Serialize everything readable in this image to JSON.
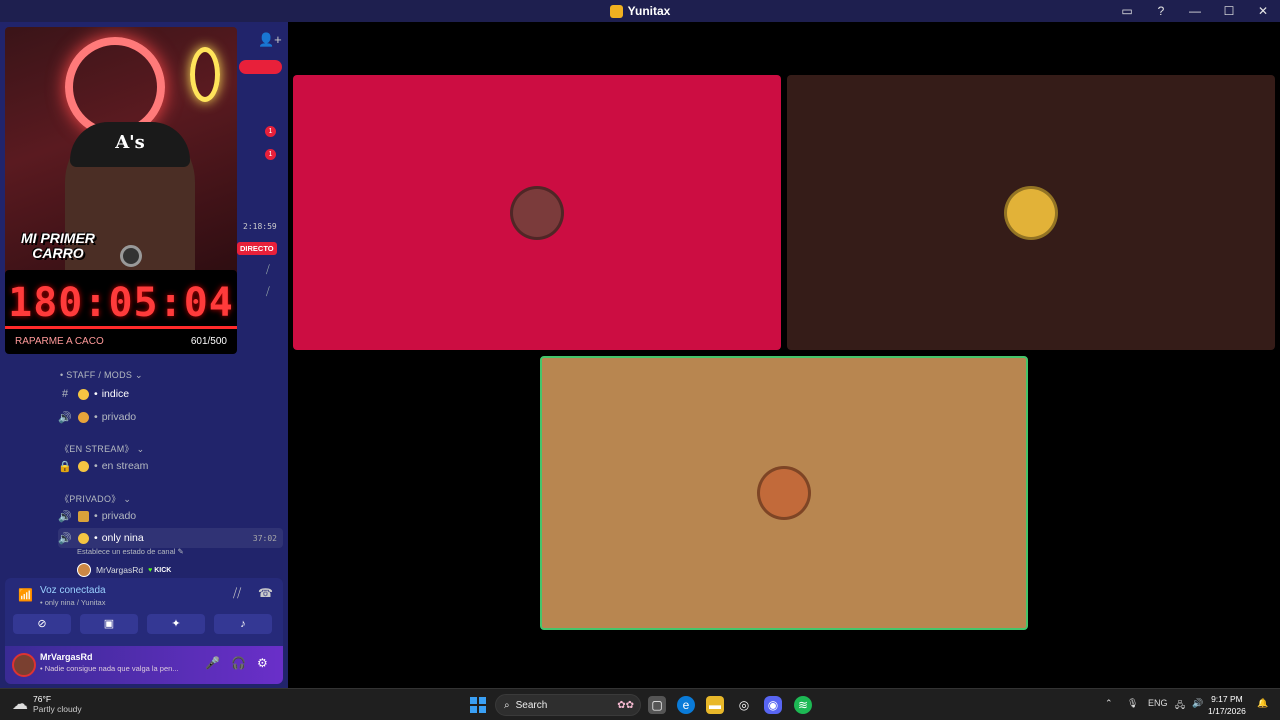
{
  "window": {
    "title": "Yunitax",
    "controls": [
      "▭",
      "?",
      "—",
      "☐",
      "✕"
    ]
  },
  "overlay": {
    "cap_text": "A's",
    "banner_line1": "MI PRIMER",
    "banner_line2": "CARRO",
    "timer": "180:05:04",
    "goal_label": "RAPARME A CACO",
    "goal_count": "601/500"
  },
  "sidebar": {
    "badges": [
      "1",
      "1"
    ],
    "stream_time": "2:18:59",
    "live_label": "DIRECTO",
    "categories": {
      "staff": "• STAFF / MODS ⌄",
      "en_stream": "《EN STREAM》 ⌄",
      "privado": "《PRIVADO》 ⌄"
    },
    "channels": {
      "indice": "indice",
      "privado1": "privado",
      "en_stream": "en stream",
      "privado2": "privado",
      "only_nina": "only nina",
      "only_nina_time": "37:02"
    },
    "channel_status": "Establece un estado de canal ✎",
    "member": {
      "name": "MrVargasRd",
      "tag": "KICK"
    }
  },
  "voice": {
    "title": "Voz conectada",
    "subtitle": "• only nina / Yunitax"
  },
  "user": {
    "name": "MrVargasRd",
    "status": "• Nadie consigue nada que valga la pen..."
  },
  "tiles": [
    {
      "name": "red-tile",
      "color": "#cc0d42",
      "avatar_color": "#7b3b3b"
    },
    {
      "name": "brown-tile",
      "color": "#351c18",
      "avatar_color": "#e2b238"
    },
    {
      "name": "tan-tile",
      "color": "#b88650",
      "avatar_color": "#c26a3a"
    }
  ],
  "taskbar": {
    "temp": "76°F",
    "weather": "Partly cloudy",
    "search_label": "Search",
    "lang": "ENG",
    "time": "9:17 PM",
    "date": "1/17/2026"
  }
}
